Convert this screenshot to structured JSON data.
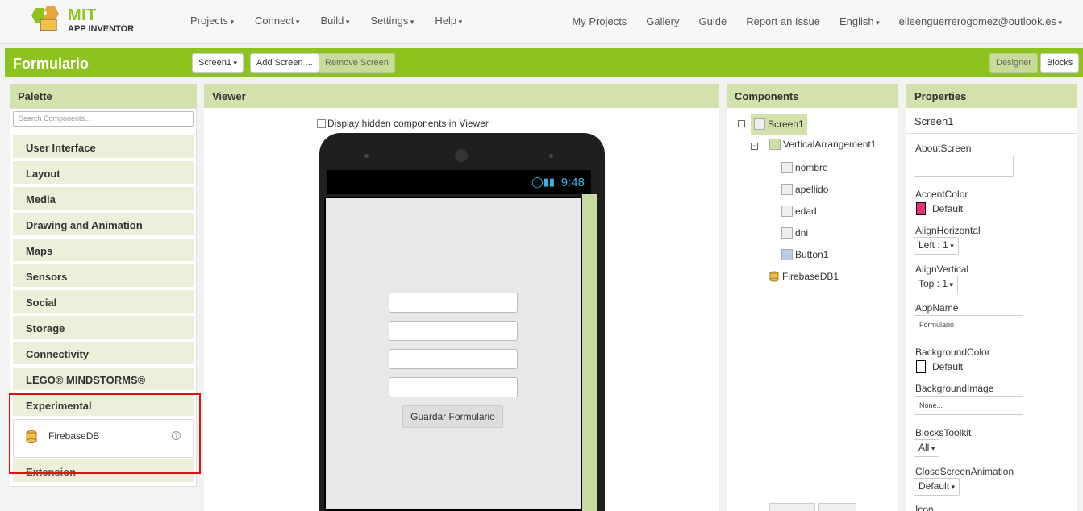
{
  "brand": {
    "name": "MIT",
    "sub": "APP INVENTOR"
  },
  "nav": {
    "left": [
      "Projects",
      "Connect",
      "Build",
      "Settings",
      "Help"
    ],
    "my_projects": "My Projects",
    "gallery": "Gallery",
    "guide": "Guide",
    "report": "Report an Issue",
    "language": "English",
    "account": "eileenguerrerogomez@outlook.es"
  },
  "project_bar": {
    "title": "Formulario",
    "screen_select": "Screen1",
    "add_screen": "Add Screen ...",
    "remove_screen": "Remove Screen",
    "designer": "Designer",
    "blocks": "Blocks"
  },
  "palette": {
    "title": "Palette",
    "search_placeholder": "Search Components...",
    "categories": [
      "User Interface",
      "Layout",
      "Media",
      "Drawing and Animation",
      "Maps",
      "Sensors",
      "Social",
      "Storage",
      "Connectivity",
      "LEGO® MINDSTORMS®",
      "Experimental"
    ],
    "experimental_item": "FirebaseDB",
    "extension": "Extension"
  },
  "viewer": {
    "title": "Viewer",
    "hidden_checkbox_label": "Display hidden components in Viewer",
    "status_time": "9:48",
    "button_label": "Guardar Formulario"
  },
  "components": {
    "title": "Components",
    "screen": "Screen1",
    "arrangement": "VerticalArrangement1",
    "children": [
      "nombre",
      "apellido",
      "edad",
      "dni",
      "Button1"
    ],
    "firebase": "FirebaseDB1"
  },
  "properties": {
    "title": "Properties",
    "component": "Screen1",
    "about_screen": "AboutScreen",
    "accent_color": "AccentColor",
    "accent_value": "Default",
    "accent_hex": "#e8327a",
    "align_h": "AlignHorizontal",
    "align_h_value": "Left : 1",
    "align_v": "AlignVertical",
    "align_v_value": "Top : 1",
    "app_name": "AppName",
    "app_name_value": "Formulario",
    "bg_color": "BackgroundColor",
    "bg_color_value": "Default",
    "bg_image": "BackgroundImage",
    "bg_image_value": "None...",
    "blocks_toolkit": "BlocksToolkit",
    "blocks_toolkit_value": "All",
    "close_anim": "CloseScreenAnimation",
    "close_anim_value": "Default",
    "icon": "Icon"
  }
}
